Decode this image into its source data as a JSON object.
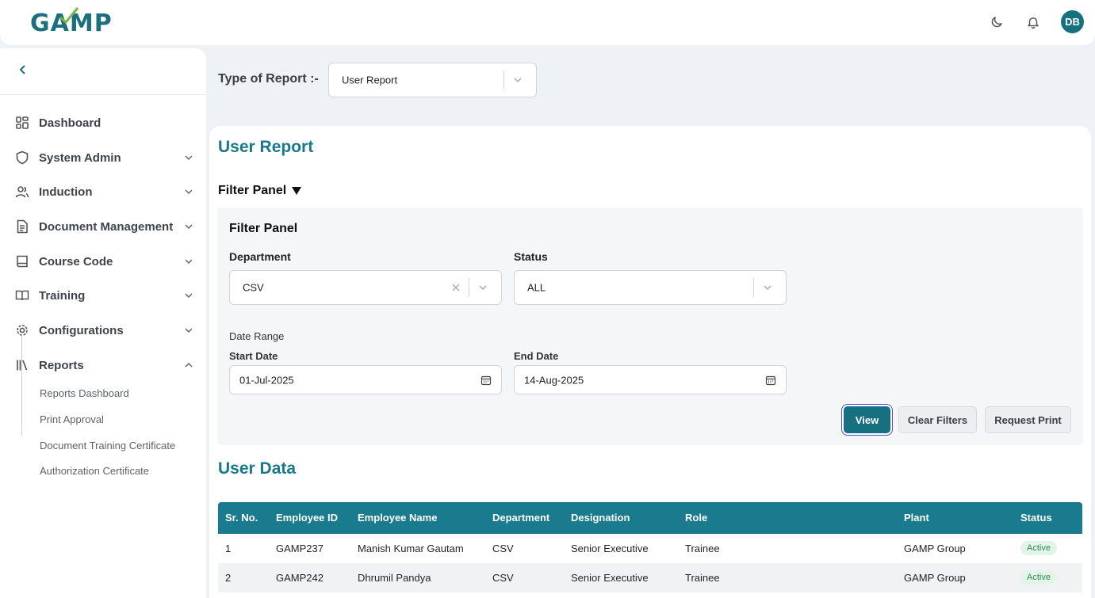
{
  "app": {
    "logo": "GAMP",
    "user_initials": "DB"
  },
  "sidebar": {
    "items": [
      {
        "label": "Dashboard",
        "icon": "grid-icon",
        "expandable": false
      },
      {
        "label": "System Admin",
        "icon": "shield-icon",
        "expandable": true
      },
      {
        "label": "Induction",
        "icon": "users-icon",
        "expandable": true
      },
      {
        "label": "Document Management",
        "icon": "document-icon",
        "expandable": true
      },
      {
        "label": "Course Code",
        "icon": "book-icon",
        "expandable": true
      },
      {
        "label": "Training",
        "icon": "open-book-icon",
        "expandable": true
      },
      {
        "label": "Configurations",
        "icon": "gear-icon",
        "expandable": true
      },
      {
        "label": "Reports",
        "icon": "library-icon",
        "expandable": true,
        "expanded": true
      }
    ],
    "report_subitems": [
      "Reports Dashboard",
      "Print Approval",
      "Document Training Certificate",
      "Authorization Certificate"
    ]
  },
  "report_type": {
    "label": "Type of Report :-",
    "value": "User Report"
  },
  "report": {
    "title": "User Report",
    "filter_toggle": "Filter Panel",
    "filter_title": "Filter Panel",
    "department_label": "Department",
    "department_value": "CSV",
    "status_label": "Status",
    "status_value": "ALL",
    "date_range_label": "Date Range",
    "start_label": "Start Date",
    "start_value": "01-Jul-2025",
    "end_label": "End Date",
    "end_value": "14-Aug-2025",
    "btn_view": "View",
    "btn_clear": "Clear Filters",
    "btn_print": "Request Print"
  },
  "data_section": {
    "title": "User Data",
    "columns": [
      "Sr. No.",
      "Employee ID",
      "Employee Name",
      "Department",
      "Designation",
      "Role",
      "Plant",
      "Status"
    ],
    "rows": [
      [
        "1",
        "GAMP237",
        "Manish Kumar Gautam",
        "CSV",
        "Senior Executive",
        "Trainee",
        "GAMP Group",
        "Active"
      ],
      [
        "2",
        "GAMP242",
        "Dhrumil Pandya",
        "CSV",
        "Senior Executive",
        "Trainee",
        "GAMP Group",
        "Active"
      ]
    ]
  },
  "colors": {
    "brand": "#16707f",
    "table_header": "#197b8d",
    "heading": "#19788a",
    "active_badge": "#2e8b57"
  }
}
